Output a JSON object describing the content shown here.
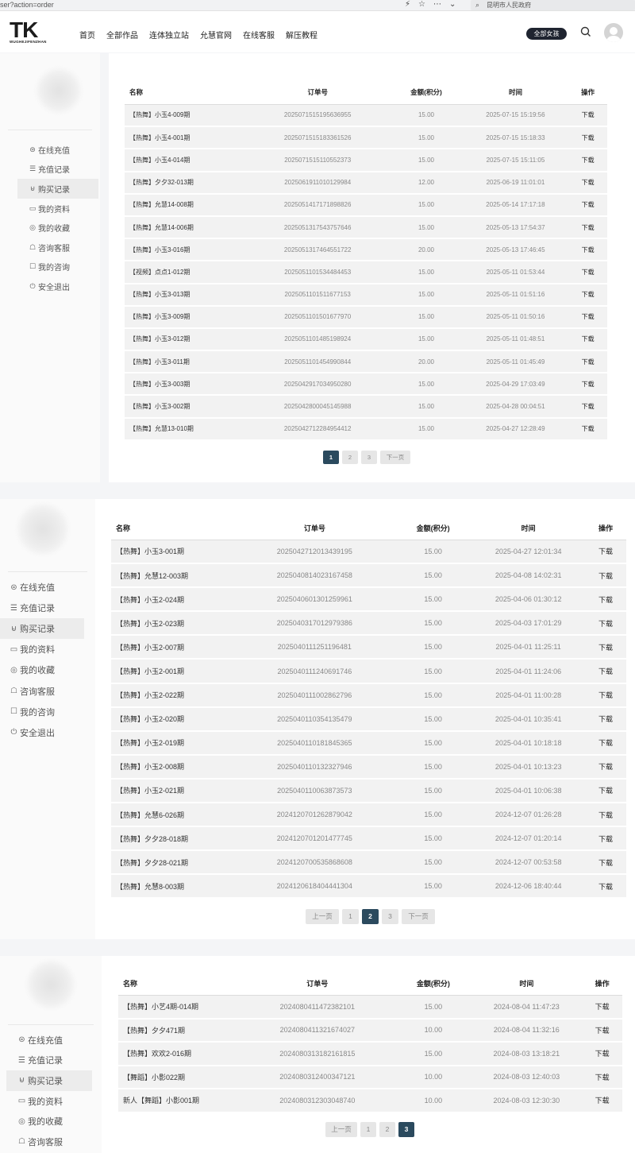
{
  "browser": {
    "url_fragment": "ser?action=order",
    "search_text": "昆明市人民政府"
  },
  "site": {
    "logo_main": "TK",
    "logo_sub": "WUGHEJIFENZHAN",
    "nav": [
      "首页",
      "全部作品",
      "连体独立站",
      "允慧官网",
      "在线客服",
      "解压教程"
    ],
    "category_button": "全部女孩"
  },
  "menu": [
    "在线充值",
    "充值记录",
    "购买记录",
    "我的资料",
    "我的收藏",
    "咨询客服",
    "我的咨询",
    "安全退出"
  ],
  "menu_icons": [
    "coin-icon",
    "list-icon",
    "bag-icon",
    "id-card-icon",
    "star-circle-icon",
    "headset-icon",
    "message-icon",
    "power-icon"
  ],
  "active_menu": "购买记录",
  "table_headers": [
    "名称",
    "订单号",
    "金额(积分)",
    "时间",
    "操作"
  ],
  "pages": [
    {
      "rows": [
        [
          "【热舞】小玉4-009期",
          "2025071515195636955",
          "15.00",
          "2025-07-15 15:19:56",
          "下载"
        ],
        [
          "【热舞】小玉4-001期",
          "2025071515183361526",
          "15.00",
          "2025-07-15 15:18:33",
          "下载"
        ],
        [
          "【热舞】小玉4-014期",
          "2025071515110552373",
          "15.00",
          "2025-07-15 15:11:05",
          "下载"
        ],
        [
          "【热舞】夕夕32-013期",
          "2025061911010129984",
          "12.00",
          "2025-06-19 11:01:01",
          "下载"
        ],
        [
          "【热舞】允慧14-008期",
          "2025051417171898826",
          "15.00",
          "2025-05-14 17:17:18",
          "下载"
        ],
        [
          "【热舞】允慧14-006期",
          "2025051317543757646",
          "15.00",
          "2025-05-13 17:54:37",
          "下载"
        ],
        [
          "【热舞】小玉3-016期",
          "2025051317464551722",
          "20.00",
          "2025-05-13 17:46:45",
          "下载"
        ],
        [
          "【视频】点点1-012期",
          "2025051101534484453",
          "15.00",
          "2025-05-11 01:53:44",
          "下载"
        ],
        [
          "【热舞】小玉3-013期",
          "2025051101511677153",
          "15.00",
          "2025-05-11 01:51:16",
          "下载"
        ],
        [
          "【热舞】小玉3-009期",
          "2025051101501677970",
          "15.00",
          "2025-05-11 01:50:16",
          "下载"
        ],
        [
          "【热舞】小玉3-012期",
          "2025051101485198924",
          "15.00",
          "2025-05-11 01:48:51",
          "下载"
        ],
        [
          "【热舞】小玉3-011期",
          "2025051101454990844",
          "20.00",
          "2025-05-11 01:45:49",
          "下载"
        ],
        [
          "【热舞】小玉3-003期",
          "2025042917034950280",
          "15.00",
          "2025-04-29 17:03:49",
          "下载"
        ],
        [
          "【热舞】小玉3-002期",
          "2025042800045145988",
          "15.00",
          "2025-04-28 00:04:51",
          "下载"
        ],
        [
          "【热舞】允慧13-010期",
          "2025042712284954412",
          "15.00",
          "2025-04-27 12:28:49",
          "下载"
        ]
      ],
      "pagination": [
        "1",
        "2",
        "3",
        "下一页"
      ],
      "current": "1"
    },
    {
      "rows": [
        [
          "【热舞】小玉3-001期",
          "2025042712013439195",
          "15.00",
          "2025-04-27 12:01:34",
          "下载"
        ],
        [
          "【热舞】允慧12-003期",
          "2025040814023167458",
          "15.00",
          "2025-04-08 14:02:31",
          "下载"
        ],
        [
          "【热舞】小玉2-024期",
          "2025040601301259961",
          "15.00",
          "2025-04-06 01:30:12",
          "下载"
        ],
        [
          "【热舞】小玉2-023期",
          "2025040317012979386",
          "15.00",
          "2025-04-03 17:01:29",
          "下载"
        ],
        [
          "【热舞】小玉2-007期",
          "2025040111251196481",
          "15.00",
          "2025-04-01 11:25:11",
          "下载"
        ],
        [
          "【热舞】小玉2-001期",
          "2025040111240691746",
          "15.00",
          "2025-04-01 11:24:06",
          "下载"
        ],
        [
          "【热舞】小玉2-022期",
          "2025040111002862796",
          "15.00",
          "2025-04-01 11:00:28",
          "下载"
        ],
        [
          "【热舞】小玉2-020期",
          "2025040110354135479",
          "15.00",
          "2025-04-01 10:35:41",
          "下载"
        ],
        [
          "【热舞】小玉2-019期",
          "2025040110181845365",
          "15.00",
          "2025-04-01 10:18:18",
          "下载"
        ],
        [
          "【热舞】小玉2-008期",
          "2025040110132327946",
          "15.00",
          "2025-04-01 10:13:23",
          "下载"
        ],
        [
          "【热舞】小玉2-021期",
          "2025040110063873573",
          "15.00",
          "2025-04-01 10:06:38",
          "下载"
        ],
        [
          "【热舞】允慧6-026期",
          "2024120701262879042",
          "15.00",
          "2024-12-07 01:26:28",
          "下载"
        ],
        [
          "【热舞】夕夕28-018期",
          "2024120701201477745",
          "15.00",
          "2024-12-07 01:20:14",
          "下载"
        ],
        [
          "【热舞】夕夕28-021期",
          "2024120700535868608",
          "15.00",
          "2024-12-07 00:53:58",
          "下载"
        ],
        [
          "【热舞】允慧8-003期",
          "2024120618404441304",
          "15.00",
          "2024-12-06 18:40:44",
          "下载"
        ]
      ],
      "pagination": [
        "上一页",
        "1",
        "2",
        "3",
        "下一页"
      ],
      "current": "2"
    },
    {
      "rows": [
        [
          "【热舞】小艺4期-014期",
          "2024080411472382101",
          "15.00",
          "2024-08-04 11:47:23",
          "下载"
        ],
        [
          "【热舞】夕夕471期",
          "2024080411321674027",
          "10.00",
          "2024-08-04 11:32:16",
          "下载"
        ],
        [
          "【热舞】欢欢2-016期",
          "2024080313182161815",
          "15.00",
          "2024-08-03 13:18:21",
          "下载"
        ],
        [
          "【舞蹈】小影022期",
          "2024080312400347121",
          "10.00",
          "2024-08-03 12:40:03",
          "下载"
        ],
        [
          "新人【舞蹈】小影001期",
          "2024080312303048740",
          "10.00",
          "2024-08-03 12:30:30",
          "下载"
        ]
      ],
      "pagination": [
        "上一页",
        "1",
        "2",
        "3"
      ],
      "current": "3"
    }
  ]
}
